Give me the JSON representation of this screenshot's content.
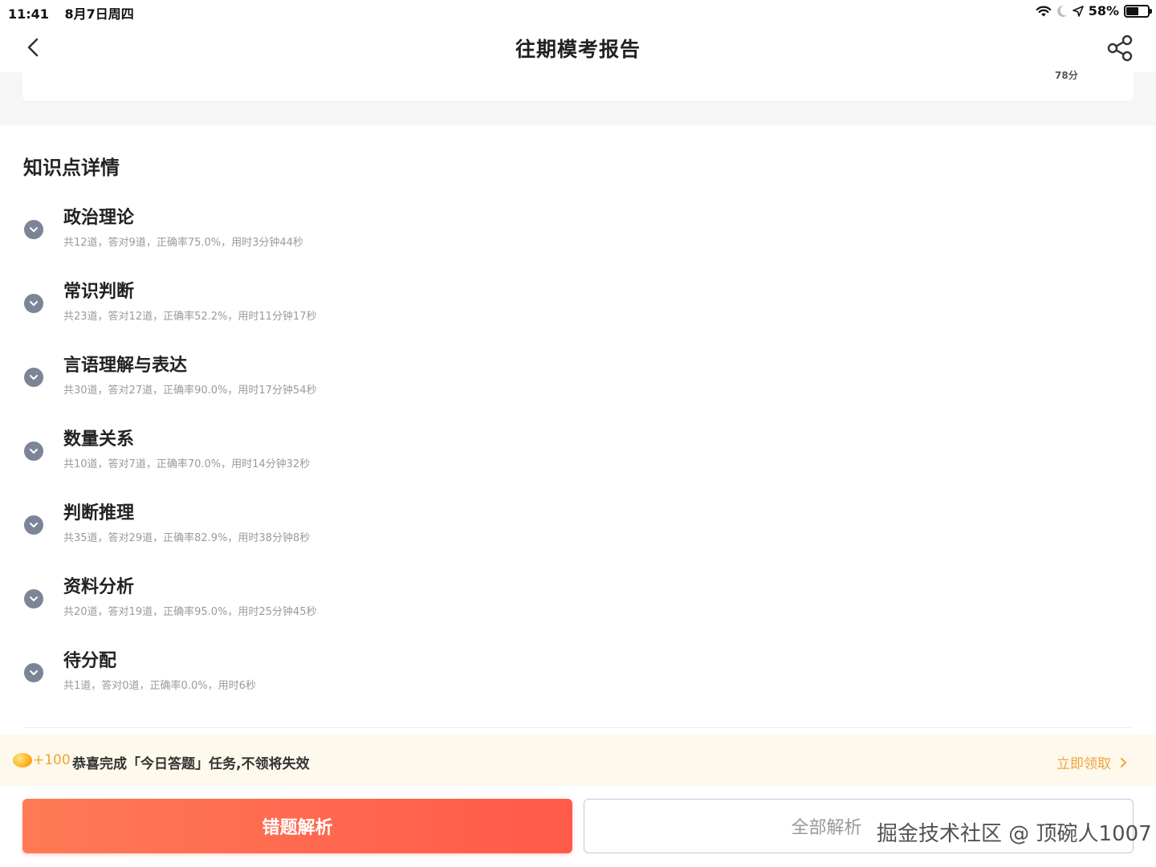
{
  "status_bar": {
    "time": "11:41",
    "date": "8月7日周四",
    "battery": "58%",
    "battery_level": 0.58,
    "icons": [
      "wifi-icon",
      "moon-icon",
      "location-icon",
      "battery-icon"
    ]
  },
  "nav": {
    "title": "往期模考报告",
    "back_icon": "chevron-left-icon",
    "share_icon": "share-icon"
  },
  "top_card": {
    "score_text": "78分"
  },
  "knowledge": {
    "section_title": "知识点详情",
    "items": [
      {
        "name": "政治理论",
        "stats": "共12道，答对9道，正确率75.0%，用时3分钟44秒"
      },
      {
        "name": "常识判断",
        "stats": "共23道，答对12道，正确率52.2%，用时11分钟17秒"
      },
      {
        "name": "言语理解与表达",
        "stats": "共30道，答对27道，正确率90.0%，用时17分钟54秒"
      },
      {
        "name": "数量关系",
        "stats": "共10道，答对7道，正确率70.0%，用时14分钟32秒"
      },
      {
        "name": "判断推理",
        "stats": "共35道，答对29道，正确率82.9%，用时38分钟8秒"
      },
      {
        "name": "资料分析",
        "stats": "共20道，答对19道，正确率95.0%，用时25分钟45秒"
      },
      {
        "name": "待分配",
        "stats": "共1道，答对0道，正确率0.0%，用时6秒"
      }
    ]
  },
  "reward": {
    "amount": "+100",
    "message": "恭喜完成「今日答题」任务,不领将失效",
    "claim_label": "立即领取",
    "accent_color": "#f2a33a"
  },
  "buttons": {
    "wrong_analysis": "错题解析",
    "all_analysis": "全部解析",
    "primary_color": "#ff5a4a"
  },
  "watermark": "掘金技术社区 @ 顶碗人1007"
}
